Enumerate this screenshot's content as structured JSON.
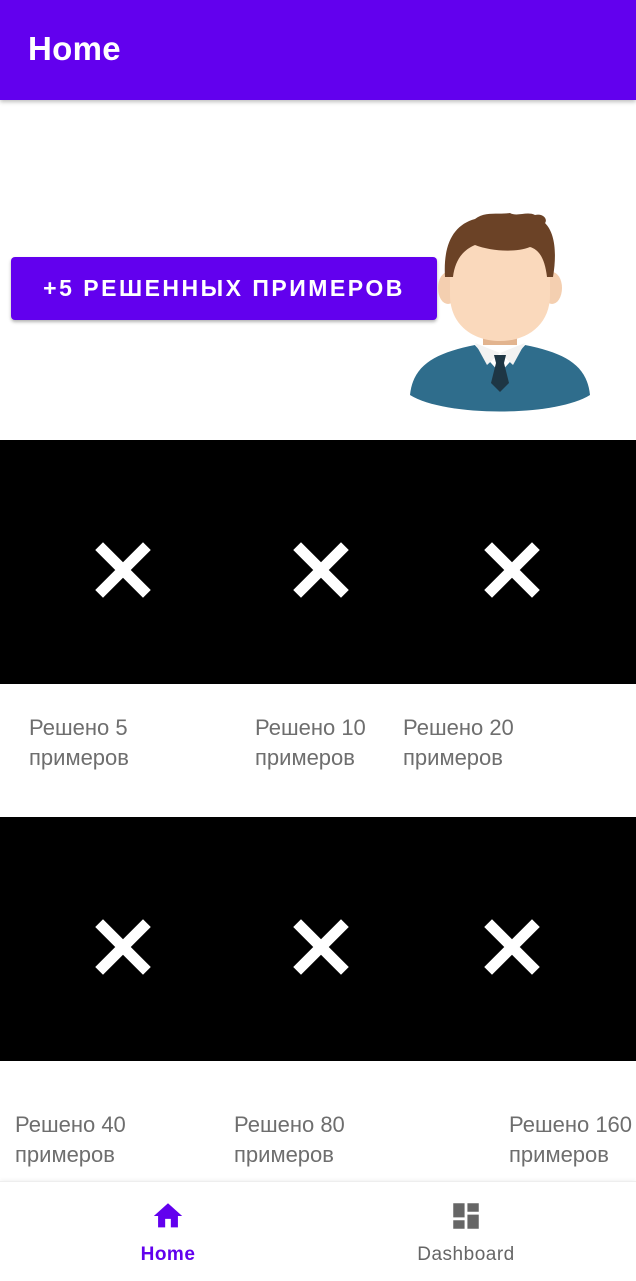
{
  "app_bar": {
    "title": "Home"
  },
  "hero": {
    "action_button_label": "+5 РЕШЕННЫХ ПРИМЕРОВ",
    "avatar_icon": "person-avatar-icon"
  },
  "achievements": [
    {
      "label": "Решено 5\nпримеров",
      "icon": "close-icon"
    },
    {
      "label": "Решено 10\nпримеров",
      "icon": "close-icon"
    },
    {
      "label": "Решено 20\nпримеров",
      "icon": "close-icon"
    },
    {
      "label": "Решено 40\nпримеров",
      "icon": "close-icon"
    },
    {
      "label": "Решено 80\nпримеров",
      "icon": "close-icon"
    },
    {
      "label": "Решено 160\nпримеров",
      "icon": "close-icon"
    }
  ],
  "bottom_nav": {
    "items": [
      {
        "label": "Home",
        "icon": "home-icon",
        "active": true
      },
      {
        "label": "Dashboard",
        "icon": "dashboard-icon",
        "active": false
      }
    ]
  },
  "colors": {
    "primary": "#6200ee",
    "badge_background": "#000000",
    "label_text": "#6e6e6e",
    "inactive_nav": "#666666"
  }
}
